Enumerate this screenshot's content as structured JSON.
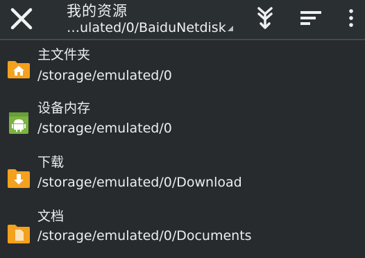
{
  "header": {
    "title": "我的资源",
    "path": "…ulated/0/BaiduNetdisk"
  },
  "icons": {
    "close": "close-icon",
    "sort": "sort-download-icon",
    "filter": "filter-lines-icon",
    "more": "more-vert-icon"
  },
  "colors": {
    "background": "#272b2e",
    "folder_orange": "#f4a11e",
    "android_green": "#7cb342"
  },
  "items": [
    {
      "name": "主文件夹",
      "path": "/storage/emulated/0",
      "icon": "home-folder-icon"
    },
    {
      "name": "设备内存",
      "path": "/storage/emulated/0",
      "icon": "android-storage-icon"
    },
    {
      "name": "下载",
      "path": "/storage/emulated/0/Download",
      "icon": "download-folder-icon"
    },
    {
      "name": "文档",
      "path": "/storage/emulated/0/Documents",
      "icon": "documents-folder-icon"
    }
  ]
}
